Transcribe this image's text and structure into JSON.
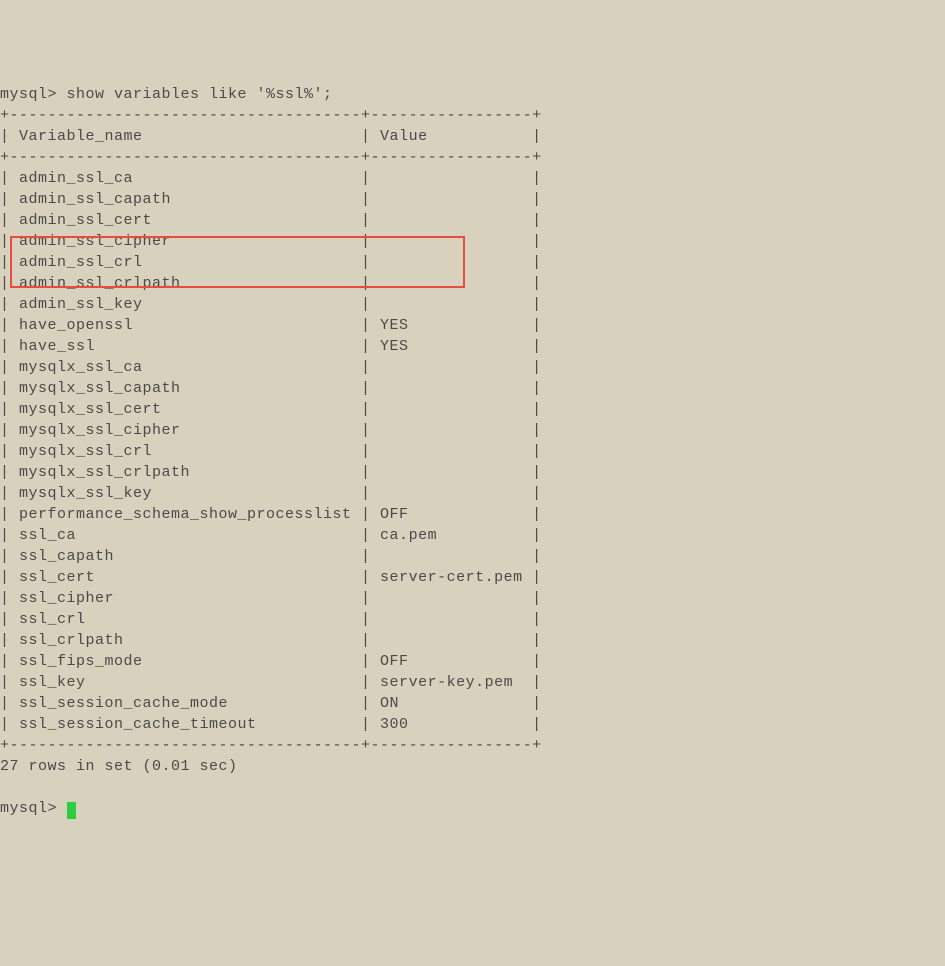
{
  "prompt_line": "mysql> show variables like '%ssl%';",
  "border_top": "+-------------------------------------+-----------------+",
  "header_row": "| Variable_name                       | Value           |",
  "border_mid": "+-------------------------------------+-----------------+",
  "rows": [
    "| admin_ssl_ca                        |                 |",
    "| admin_ssl_capath                    |                 |",
    "| admin_ssl_cert                      |                 |",
    "| admin_ssl_cipher                    |                 |",
    "| admin_ssl_crl                       |                 |",
    "| admin_ssl_crlpath                   |                 |",
    "| admin_ssl_key                       |                 |",
    "| have_openssl                        | YES             |",
    "| have_ssl                            | YES             |",
    "| mysqlx_ssl_ca                       |                 |",
    "| mysqlx_ssl_capath                   |                 |",
    "| mysqlx_ssl_cert                     |                 |",
    "| mysqlx_ssl_cipher                   |                 |",
    "| mysqlx_ssl_crl                      |                 |",
    "| mysqlx_ssl_crlpath                  |                 |",
    "| mysqlx_ssl_key                      |                 |",
    "| performance_schema_show_processlist | OFF             |",
    "| ssl_ca                              | ca.pem          |",
    "| ssl_capath                          |                 |",
    "| ssl_cert                            | server-cert.pem |",
    "| ssl_cipher                          |                 |",
    "| ssl_crl                             |                 |",
    "| ssl_crlpath                         |                 |",
    "| ssl_fips_mode                       | OFF             |",
    "| ssl_key                             | server-key.pem  |",
    "| ssl_session_cache_mode              | ON              |",
    "| ssl_session_cache_timeout           | 300             |"
  ],
  "border_bot": "+-------------------------------------+-----------------+",
  "summary": "27 rows in set (0.01 sec)",
  "blank": "",
  "prompt2": "mysql> "
}
